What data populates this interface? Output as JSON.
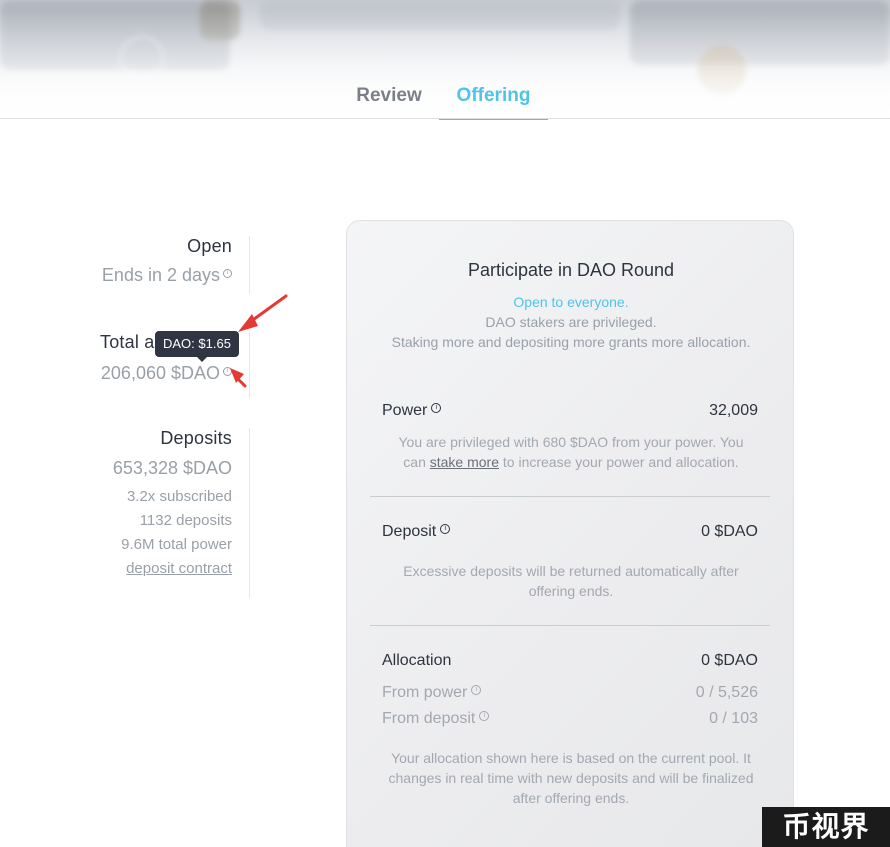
{
  "tabs": [
    {
      "label": "Review",
      "active": false
    },
    {
      "label": "Offering",
      "active": true
    }
  ],
  "stats": {
    "open": {
      "title": "Open",
      "value": "Ends in 2 days"
    },
    "total": {
      "title": "Total a",
      "value": "206,060 $DAO"
    },
    "deposits": {
      "title": "Deposits",
      "value": "653,328 $DAO",
      "subscribed": "3.2x subscribed",
      "count": "1132 deposits",
      "power": "9.6M total power",
      "contract_link": "deposit contract"
    }
  },
  "tooltip": {
    "text": "DAO: $1.65"
  },
  "card": {
    "title": "Participate in DAO Round",
    "open_text": "Open to everyone.",
    "line1": "DAO stakers are privileged.",
    "line2": "Staking more and depositing more grants more allocation.",
    "power": {
      "label": "Power",
      "value": "32,009",
      "note_part1": "You are privileged with 680 $DAO from your power. You",
      "note_part2_pre": "can",
      "note_link": "stake more",
      "note_part2_post": "to increase your power and allocation."
    },
    "deposit": {
      "label": "Deposit",
      "value": "0 $DAO",
      "note_line1": "Excessive deposits will be returned automatically after",
      "note_line2": "offering ends."
    },
    "allocation": {
      "label": "Allocation",
      "value": "0 $DAO",
      "from_power_label": "From power",
      "from_power_value": "0 / 5,526",
      "from_deposit_label": "From deposit",
      "from_deposit_value": "0 / 103",
      "note_line1": "Your allocation shown here is based on the current pool. It",
      "note_line2": "changes in real time with new deposits and will be finalized",
      "note_line3": "after offering ends."
    }
  },
  "icons": {
    "info": "info-circle-icon",
    "arrow": "red-arrow-icon"
  },
  "colors": {
    "accent": "#4fc3e8",
    "annotation": "#e53935",
    "tooltip_bg": "#2f3542"
  },
  "watermark": {
    "text": "币视界"
  }
}
